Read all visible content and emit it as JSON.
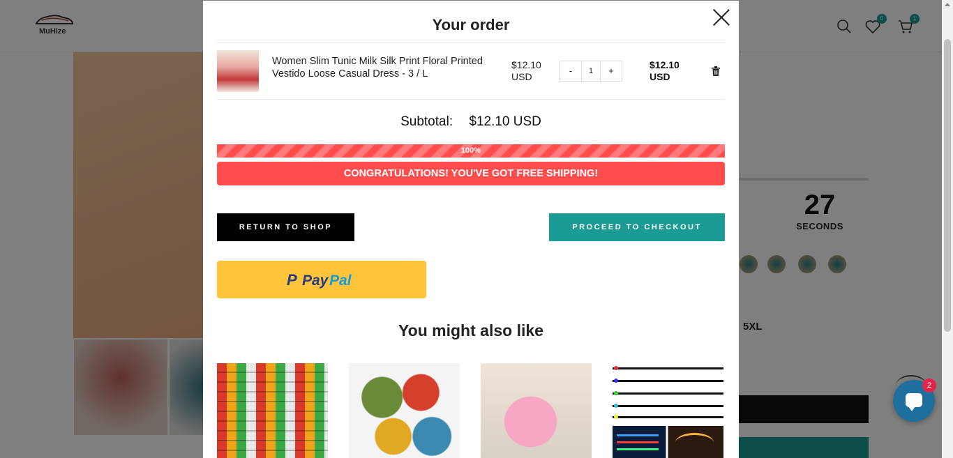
{
  "store": {
    "logo_text": "MuHize",
    "wishlist_count": "0",
    "cart_count": "1"
  },
  "background": {
    "countdown_value": "27",
    "countdown_label": "SECONDS",
    "size_label": "5XL"
  },
  "chat": {
    "unread_count": "2"
  },
  "modal": {
    "title": "Your order",
    "item": {
      "title": "Women Slim Tunic Milk Silk Print Floral Printed Vestido Loose Casual Dress - 3 / L",
      "price": "$12.10 USD",
      "quantity_minus": "-",
      "quantity": "1",
      "quantity_plus": "+",
      "line_total": "$12.10 USD"
    },
    "subtotal_label": "Subtotal:",
    "subtotal_value": "$12.10 USD",
    "shipping_progress_percent": 100,
    "shipping_progress_text": "100%",
    "free_shipping_message": "CONGRATULATIONS! YOU'VE GOT FREE SHIPPING!",
    "return_button": "RETURN TO SHOP",
    "checkout_button": "PROCEED TO CHECKOUT",
    "paypal_p": "P",
    "paypal_pay": "Pay",
    "paypal_pal": "Pal",
    "recommendations_heading": "You might also like"
  },
  "colors": {
    "accent_teal": "#1a9c95",
    "alert_red": "#ff4d4d",
    "paypal_yellow": "#ffc439"
  }
}
